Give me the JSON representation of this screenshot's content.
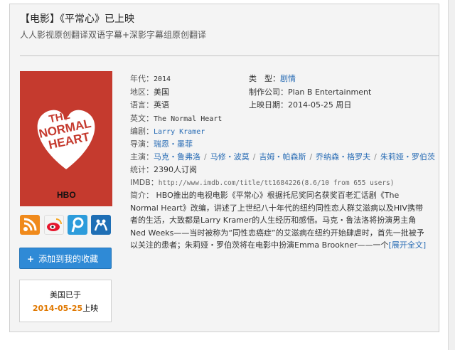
{
  "header": {
    "title": "【电影】《平常心》已上映",
    "subtitle": "人人影视原创翻译双语字幕+深影字幕组原创翻译"
  },
  "poster": {
    "title_lines": [
      "THE",
      "NORMAL",
      "HEART"
    ],
    "brand": "HBO"
  },
  "share_icons": [
    "rss-icon",
    "weibo-icon",
    "tencent-weibo-icon",
    "renren-icon"
  ],
  "collect_button": {
    "plus": "+",
    "label": "添加到我的收藏"
  },
  "release_box": {
    "line1": "美国已于",
    "date": "2014-05-25",
    "suffix": "上映"
  },
  "info": {
    "year_label": "年代：",
    "year": "2014",
    "type_label": "类　型：",
    "type": "剧情",
    "region_label": "地区：",
    "region": "美国",
    "company_label": "制作公司：",
    "company": "Plan B Entertainment",
    "language_label": "语言：",
    "language": "英语",
    "date_label": "上映日期：",
    "date": "2014-05-25 周日",
    "en_label": "英文：",
    "en_title": "The Normal Heart",
    "writer_label": "编剧：",
    "writer": "Larry Kramer",
    "director_label": "导演：",
    "director": "瑞恩・墨菲",
    "cast_label": "主演：",
    "cast": [
      "马克・鲁弗洛",
      "马修・波莫",
      "吉姆・帕森斯",
      "乔纳森・格罗夫",
      "朱莉娅・罗伯茨"
    ],
    "stats_label": "统计：",
    "stats": "2390人订阅",
    "imdb_label": "IMDB：",
    "imdb": "http://www.imdb.com/title/tt1684226(8.6/10 from 655 users)",
    "intro_label": "简介：",
    "intro": "HBO推出的电视电影《平常心》根据托尼奖同名获奖百老汇话剧《The Normal Heart》改编，讲述了上世纪八十年代的纽约同性恋人群艾滋病以及HIV携带者的生活，大致都是Larry Kramer的人生经历和感悟。马克・鲁法洛将扮演男主角Ned Weeks——当时被称为“同性恋癌症”的艾滋病在纽约开始肆虐时，首先一批被予以关注的患者；朱莉娅・罗伯茨将在电影中扮演Emma Brookner——一个",
    "expand": "[展开全文]"
  },
  "colors": {
    "accent": "#2f8ad6",
    "date_orange": "#e07800",
    "poster_red": "#c53a2e",
    "link": "#2a6db5"
  }
}
